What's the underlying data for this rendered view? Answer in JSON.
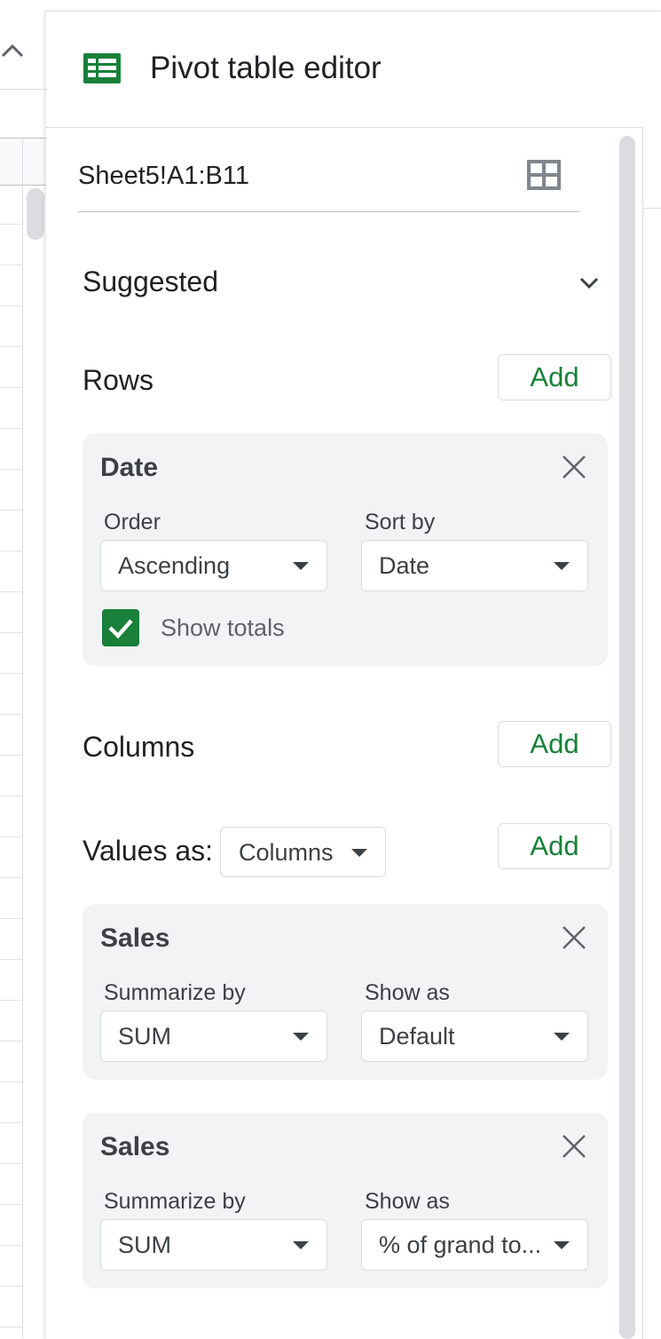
{
  "panel": {
    "title": "Pivot table editor",
    "data_range": "Sheet5!A1:B11",
    "logo_icon": "google-sheets-icon"
  },
  "suggested": {
    "label": "Suggested"
  },
  "rows": {
    "label": "Rows",
    "add_label": "Add",
    "field": {
      "name": "Date",
      "order_label": "Order",
      "order_value": "Ascending",
      "sort_by_label": "Sort by",
      "sort_by_value": "Date",
      "show_totals_label": "Show totals",
      "show_totals_checked": true
    }
  },
  "columns": {
    "label": "Columns",
    "add_label": "Add"
  },
  "values": {
    "label": "Values as:",
    "layout_value": "Columns",
    "add_label": "Add",
    "fields": [
      {
        "name": "Sales",
        "summarize_label": "Summarize by",
        "summarize_value": "SUM",
        "show_as_label": "Show as",
        "show_as_value": "Default"
      },
      {
        "name": "Sales",
        "summarize_label": "Summarize by",
        "summarize_value": "SUM",
        "show_as_label": "Show as",
        "show_as_value": "% of grand to..."
      }
    ]
  },
  "colors": {
    "accent_green": "#188038",
    "card_bg": "#f1f3f4",
    "border": "#dadce0"
  }
}
